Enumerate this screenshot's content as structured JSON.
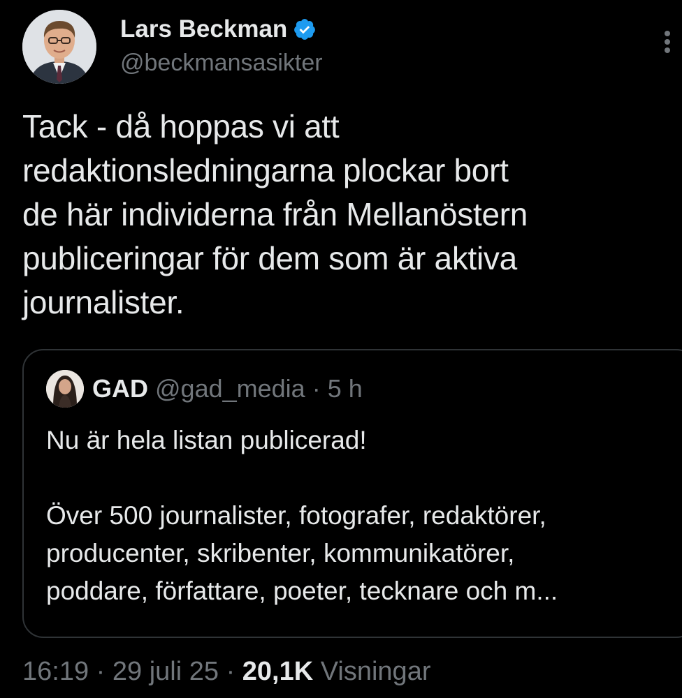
{
  "author": {
    "display_name": "Lars Beckman",
    "handle": "@beckmansasikter",
    "verified": true,
    "verified_color": "#1d9bf0",
    "avatar_icon": "profile-photo"
  },
  "tweet": {
    "text_lines": [
      "Tack - då hoppas vi att",
      "redaktionsledningarna plockar bort",
      "de här individerna från Mellanöstern",
      "publiceringar för dem som är aktiva",
      "journalister."
    ]
  },
  "quoted_tweet": {
    "display_name": "GAD",
    "handle": "@gad_media",
    "separator": "·",
    "time": "5 h",
    "avatar_icon": "profile-photo",
    "text_lines": [
      "Nu är hela listan publicerad!",
      "",
      "Över 500 journalister, fotografer, redaktörer,",
      "producenter, skribenter, kommunikatörer,",
      "poddare, författare, poeter, tecknare och m..."
    ]
  },
  "footer": {
    "time": "16:19",
    "separator": "·",
    "date": "29 juli 25",
    "views_count": "20,1K",
    "views_label": "Visningar"
  },
  "colors": {
    "background": "#000000",
    "text_primary": "#e7e9ea",
    "text_secondary": "#71767b",
    "border": "#2f3336"
  }
}
